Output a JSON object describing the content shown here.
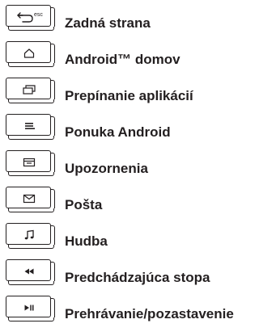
{
  "keys": [
    {
      "icon": "back-arrow-esc-icon",
      "label": "Zadná strana",
      "icon_text": "esc"
    },
    {
      "icon": "home-icon",
      "label": "Android™ domov"
    },
    {
      "icon": "app-switch-icon",
      "label": "Prepínanie aplikácií"
    },
    {
      "icon": "menu-icon",
      "label": "Ponuka Android"
    },
    {
      "icon": "notifications-icon",
      "label": "Upozornenia"
    },
    {
      "icon": "mail-icon",
      "label": "Pošta"
    },
    {
      "icon": "music-note-icon",
      "label": "Hudba"
    },
    {
      "icon": "previous-track-icon",
      "label": "Predchádzajúca stopa"
    },
    {
      "icon": "play-pause-icon",
      "label": "Prehrávanie/pozastavenie"
    }
  ]
}
